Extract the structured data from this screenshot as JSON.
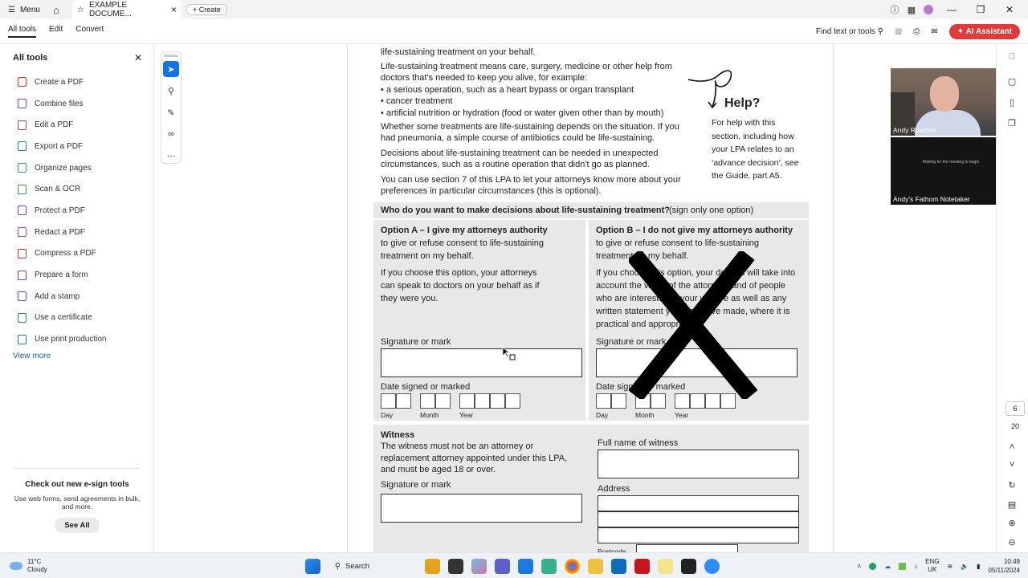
{
  "titlebar": {
    "menu": "Menu",
    "tab_title": "EXAMPLE DOCUME...",
    "create": "Create"
  },
  "toolbar": {
    "tabs": [
      "All tools",
      "Edit",
      "Convert"
    ],
    "find": "Find text or tools",
    "ai": "AI Assistant"
  },
  "leftpanel": {
    "title": "All tools",
    "items": [
      {
        "label": "Create a PDF",
        "color": "#d93025"
      },
      {
        "label": "Combine files",
        "color": "#6f42c1"
      },
      {
        "label": "Edit a PDF",
        "color": "#d6336c"
      },
      {
        "label": "Export a PDF",
        "color": "#1a8c7a"
      },
      {
        "label": "Organize pages",
        "color": "#2f9e44"
      },
      {
        "label": "Scan & OCR",
        "color": "#2f9e44"
      },
      {
        "label": "Protect a PDF",
        "color": "#6f42c1"
      },
      {
        "label": "Redact a PDF",
        "color": "#d6336c"
      },
      {
        "label": "Compress a PDF",
        "color": "#d93025"
      },
      {
        "label": "Prepare a form",
        "color": "#6f42c1"
      },
      {
        "label": "Add a stamp",
        "color": "#6f42c1"
      },
      {
        "label": "Use a certificate",
        "color": "#1a8c7a"
      },
      {
        "label": "Use print production",
        "color": "#1a8c7a"
      }
    ],
    "view_more": "View more",
    "promo_title": "Check out new e-sign tools",
    "promo_desc": "Use web forms, send agreements in bulk, and more.",
    "promo_btn": "See All"
  },
  "doc": {
    "line1": "life-sustaining treatment on your behalf.",
    "p1_1": "Life-sustaining treatment means care, surgery, medicine or other help from",
    "p1_2": "doctors that's needed to keep you alive, for example:",
    "b1": "• a serious operation, such as a heart bypass or organ transplant",
    "b2": "• cancer treatment",
    "b3": "• artificial nutrition or hydration (food or water given other than by mouth)",
    "p2_1": "Whether some treatments are life-sustaining depends on the situation. If you",
    "p2_2": "had pneumonia, a simple course of antibiotics could be life-sustaining.",
    "p3_1": "Decisions about life-sustaining treatment can be needed in unexpected",
    "p3_2": "circumstances, such as a routine operation that didn't go as planned.",
    "p4_1": "You can use section 7 of this LPA to let your attorneys know more about your",
    "p4_2": "preferences in particular circumstances (this is optional).",
    "help_title": "Help?",
    "help_body": "For help with this section, including how your LPA relates to an ‘advance decision’, see the Guide, part A5.",
    "question": "Who do you want to make decisions about life-sustaining treatment?",
    "question_note": "(sign only one option)",
    "optA_title": "Option A – I give my attorneys authority",
    "optA_1": "to give or refuse consent to life-sustaining",
    "optA_2": "treatment on my behalf.",
    "optA_3": "If you choose this option, your attorneys",
    "optA_4": "can speak to doctors on your behalf as if",
    "optA_5": "they were you.",
    "optB_title": "Option B – I do not give my attorneys authority",
    "optB_1": "to give or refuse consent to life-sustaining",
    "optB_2": "treatment on my behalf.",
    "optB_3": "If you choose this option, your doctors will take into",
    "optB_4": "account the views of the attorneys and of people",
    "optB_5": "who are interested in your welfare as well as any",
    "optB_6": "written statement you may have made, where it is",
    "optB_7": "practical and appropriate.",
    "sig_label": "Signature or mark",
    "date_label": "Date signed or marked",
    "day": "Day",
    "month": "Month",
    "year": "Year",
    "witness_title": "Witness",
    "witness_1": "The witness must not be an attorney or",
    "witness_2": "replacement attorney appointed under this LPA,",
    "witness_3": "and must be aged 18 or over.",
    "full_name": "Full name of witness",
    "address": "Address",
    "postcode": "Postcode"
  },
  "rightrail": {
    "page": "6",
    "total": "20"
  },
  "video": {
    "person1": "Andy Rowden",
    "person2": "Andy's Fathom Notetaker",
    "notetaker_text": "Waiting for the meeting to begin"
  },
  "taskbar": {
    "temp": "11°C",
    "cond": "Cloudy",
    "search": "Search",
    "lang1": "ENG",
    "lang2": "UK",
    "time": "10:49",
    "date": "05/11/2024"
  }
}
